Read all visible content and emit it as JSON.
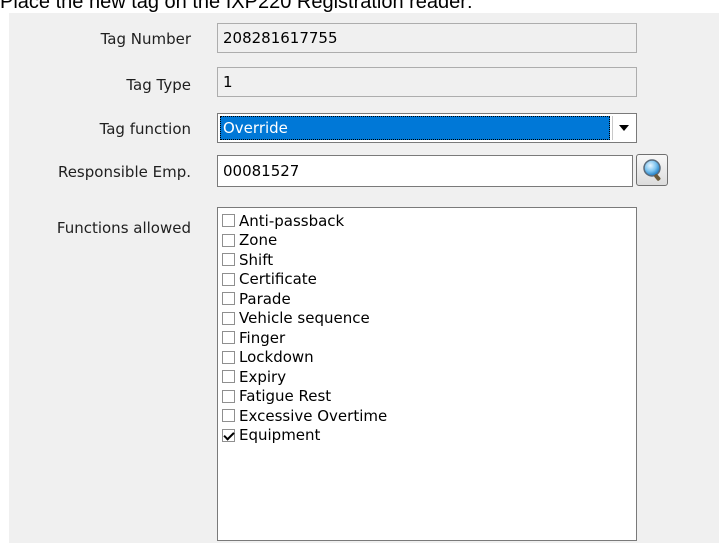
{
  "instruction": "Place the new tag on the IXP220 Registration reader:",
  "form": {
    "tag_number_label": "Tag Number",
    "tag_number_value": "208281617755",
    "tag_type_label": "Tag Type",
    "tag_type_value": "1",
    "tag_function_label": "Tag function",
    "tag_function_value": "Override",
    "responsible_emp_label": "Responsible Emp.",
    "responsible_emp_value": "00081527",
    "lookup_icon": "magnifier-icon",
    "functions_label": "Functions allowed",
    "functions": [
      {
        "label": "Anti-passback",
        "checked": false
      },
      {
        "label": "Zone",
        "checked": false
      },
      {
        "label": "Shift",
        "checked": false
      },
      {
        "label": "Certificate",
        "checked": false
      },
      {
        "label": "Parade",
        "checked": false
      },
      {
        "label": "Vehicle sequence",
        "checked": false
      },
      {
        "label": "Finger",
        "checked": false
      },
      {
        "label": "Lockdown",
        "checked": false
      },
      {
        "label": "Expiry",
        "checked": false
      },
      {
        "label": "Fatigue Rest",
        "checked": false
      },
      {
        "label": "Excessive Overtime",
        "checked": false
      },
      {
        "label": "Equipment",
        "checked": true
      }
    ]
  },
  "colors": {
    "panel_bg": "#f0f0f0",
    "selection": "#0078d7",
    "border": "#7a7a7a"
  }
}
